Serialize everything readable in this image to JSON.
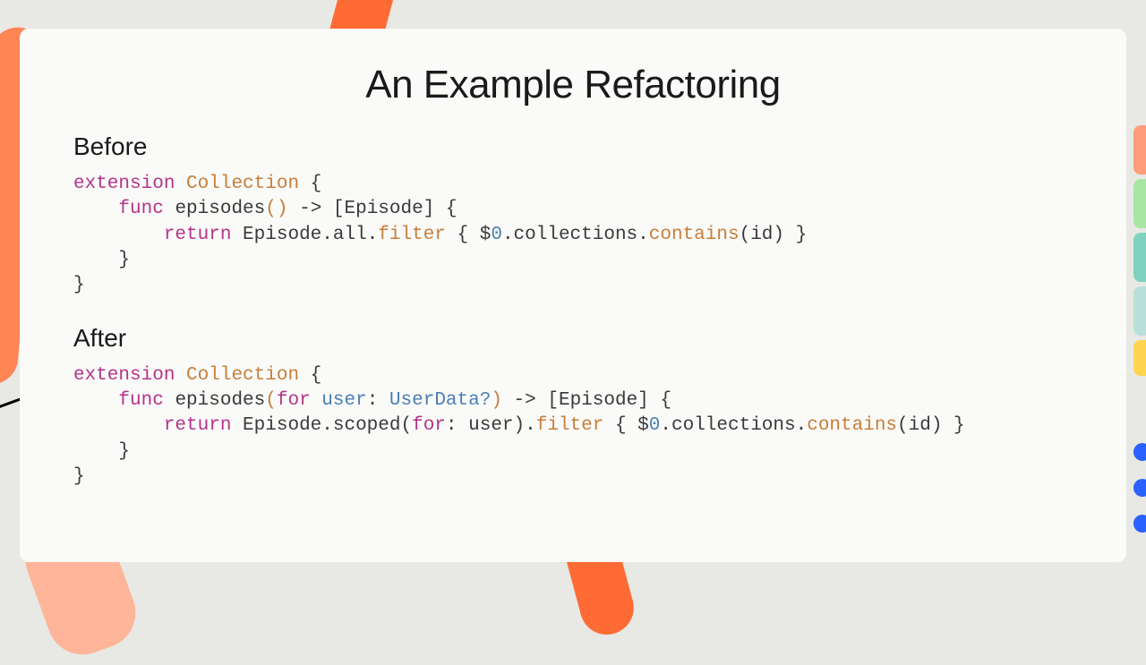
{
  "title": "An Example Refactoring",
  "before": {
    "heading": "Before",
    "code": {
      "ext_kw": "extension",
      "type_name": "Collection",
      "open_brace": " {",
      "indent1": "    ",
      "func_kw": "func",
      "func_name": " episodes",
      "parens": "()",
      "arrow_ret": " -> [Episode] {",
      "indent2": "        ",
      "return_kw": "return",
      "body1": " Episode.all.",
      "filter": "filter",
      "body2": " { $",
      "zero": "0",
      "body3": ".collections.",
      "contains": "contains",
      "body4": "(id) }",
      "close1": "    }",
      "close2": "}"
    }
  },
  "after": {
    "heading": "After",
    "code": {
      "ext_kw": "extension",
      "type_name": "Collection",
      "open_brace": " {",
      "indent1": "    ",
      "func_kw": "func",
      "func_name": " episodes",
      "paren_open": "(",
      "for_kw": "for",
      "param": " user",
      "colon": ": ",
      "ptype": "UserData?",
      "paren_close": ")",
      "arrow_ret": " -> [Episode] {",
      "indent2": "        ",
      "return_kw": "return",
      "body1": " Episode.scoped(",
      "for_kw2": "for",
      "body1b": ": user).",
      "filter": "filter",
      "body2": " { $",
      "zero": "0",
      "body3": ".collections.",
      "contains": "contains",
      "body4": "(id) }",
      "close1": "    }",
      "close2": "}"
    }
  }
}
